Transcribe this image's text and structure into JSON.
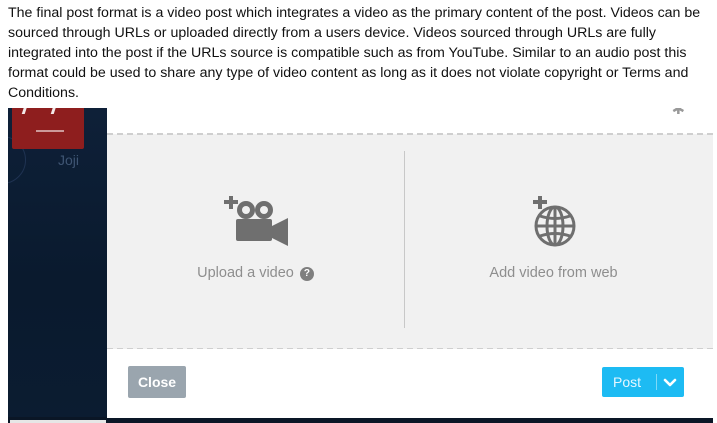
{
  "caption": {
    "text": "The final post format is a video post which integrates a video as the primary content of the post. Videos can be sourced through URLs or uploaded directly from a users device. Videos sourced through URLs are fully integrated into the post if the URLs source is compatible such as from YouTube. Similar to an audio post this format could be used to share any type of video content as long as it does not violate copyright or Terms and Conditions."
  },
  "background": {
    "blog_name": "Joji"
  },
  "modal": {
    "options": {
      "upload": {
        "label": "Upload a video",
        "icon": "video-camera-plus-icon",
        "help_glyph": "?"
      },
      "web": {
        "label": "Add video from web",
        "icon": "globe-plus-icon"
      }
    },
    "footer": {
      "close_label": "Close",
      "post_label": "Post"
    }
  },
  "colors": {
    "post_button": "#1dbbf3",
    "close_button": "#9aa5ae",
    "icon_gray": "#6f6f6f",
    "background_dark": "#0c1d33"
  }
}
